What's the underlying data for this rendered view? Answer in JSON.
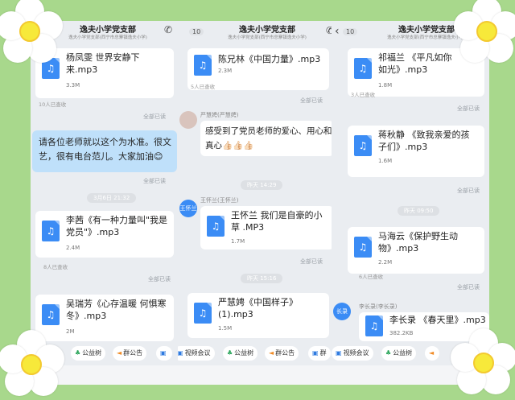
{
  "header": {
    "title": "逸夫小学党支部",
    "subtitle": "逸夫小学党支部(西宁市总寨镇逸夫小学)",
    "count": "10"
  },
  "col1": {
    "msg1": {
      "name_line1": "杨凤雯 世界安静下",
      "name_line2": "来.mp3",
      "size": "3.3M",
      "read": "10人已查收"
    },
    "read_all_1": "全部已读",
    "text_msg": {
      "line1": "请各位老师就以这个为水准。很文",
      "line2": "艺，很有电台范儿。大家加油😊"
    },
    "read_all_2": "全部已读",
    "timestamp": "3月6日 21:32",
    "msg2": {
      "name_line1": "李茜《有一种力量叫\"我是",
      "name_line2": "党员\"》.mp3",
      "size": "2.4M",
      "read": "8人已查收"
    },
    "read_all_3": "全部已读",
    "msg3": {
      "name_line1": "吴瑞芳《心存温暖 何惧寒",
      "name_line2": "冬》.mp3",
      "size": "2M"
    }
  },
  "col2": {
    "msg1": {
      "name": "陈兄林《中国力量》.mp3",
      "size": "2.3M",
      "read": "5人已查收"
    },
    "read_all_1": "全部已读",
    "sender1": "严慧娉(严慧娉)",
    "text_msg": {
      "line1": "感受到了党员老师的爱心、用心和",
      "line2": "真心👍🏻👍🏻👍🏻"
    },
    "timestamp1": "昨天 14:29",
    "sender2": "王怀兰(王怀兰)",
    "avatar2": "王怀兰",
    "msg2": {
      "name_line1": "王怀兰 我们是自豪的小",
      "name_line2": "草 .MP3",
      "size": "1.7M"
    },
    "read_all_2": "全部已读",
    "timestamp2": "昨天 15:16",
    "msg3": {
      "name_line1": "严慧娉《中国样子》",
      "name_line2": "(1).mp3",
      "size": "1.5M"
    }
  },
  "col3": {
    "msg1": {
      "name_line1": "祁福兰 《平凡如你",
      "name_line2": "如光》.mp3",
      "size": "1.8M",
      "read": "3人已查收"
    },
    "read_all_1": "全部已读",
    "msg2": {
      "name_line1": "蒋秋静 《致我亲爱的孩",
      "name_line2": "子们》.mp3",
      "size": "1.6M"
    },
    "read_all_2": "全部已读",
    "timestamp": "昨天 09:50",
    "msg3": {
      "name_line1": "马海云《保护野生动",
      "name_line2": "物》.mp3",
      "size": "2.2M",
      "read": "6人已查收"
    },
    "read_all_3": "全部已读",
    "sender": "李长录(李长录)",
    "avatar": "长录",
    "msg4": {
      "name": "李长录 《春天里》.mp3",
      "size": "382.2KB"
    }
  },
  "toolbar": {
    "gongyishu": "公益树",
    "qungonggao": "群公告",
    "shipin": "视频会议",
    "more": "群"
  },
  "icons": {
    "file": "music-file-icon",
    "tree": "tree-icon",
    "announce": "megaphone-icon",
    "video": "video-camera-icon"
  },
  "colors": {
    "background": "#a8d88c",
    "chat_bg": "#eaedf1",
    "file_icon": "#3b8cf5",
    "own_bubble": "#bfe0fa"
  }
}
